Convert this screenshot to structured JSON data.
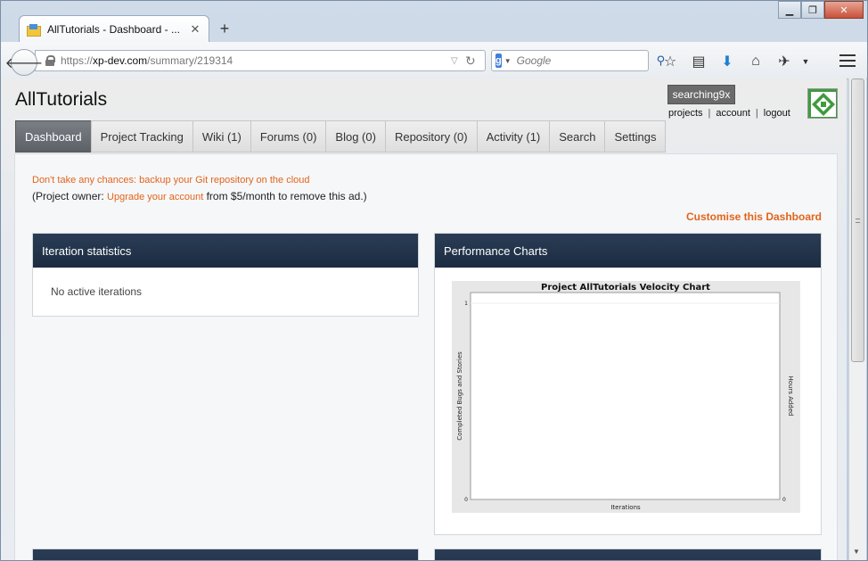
{
  "browser": {
    "tab_title": "AllTutorials - Dashboard - ...",
    "tab_close": "✕",
    "new_tab": "+",
    "url_prefix": "https://",
    "url_domain": "xp-dev.com",
    "url_path": "/summary/219314",
    "search_engine_letter": "g",
    "search_placeholder": "Google",
    "window_buttons": [
      "▁",
      "❐",
      "✕"
    ]
  },
  "site": {
    "title": "AllTutorials",
    "username": "searching9x",
    "user_links": [
      "projects",
      "account",
      "logout"
    ]
  },
  "nav": {
    "tabs": [
      {
        "label": "Dashboard",
        "active": true
      },
      {
        "label": "Project Tracking",
        "active": false
      },
      {
        "label": "Wiki (1)",
        "active": false
      },
      {
        "label": "Forums (0)",
        "active": false
      },
      {
        "label": "Blog (0)",
        "active": false
      },
      {
        "label": "Repository (0)",
        "active": false
      },
      {
        "label": "Activity (1)",
        "active": false
      },
      {
        "label": "Search",
        "active": false
      },
      {
        "label": "Settings",
        "active": false
      }
    ]
  },
  "ad": {
    "line1": "Don't take any chances: backup your Git repository on the cloud",
    "line2_prefix": "(Project owner: ",
    "line2_link": "Upgrade your account",
    "line2_suffix": " from $5/month to remove this ad.)"
  },
  "dashboard": {
    "customise": "Customise this Dashboard",
    "widgets": {
      "iteration": {
        "title": "Iteration statistics",
        "body": "No active iterations"
      },
      "performance": {
        "title": "Performance Charts"
      }
    }
  },
  "colors": {
    "accent_orange": "#e2641c",
    "widget_header": "#1f2f45"
  },
  "chart_data": {
    "type": "line",
    "title": "Project AllTutorials Velocity Chart",
    "xlabel": "Iterations",
    "ylabel": "Completed Bugs and Stories",
    "y2label": "Hours Added",
    "categories": [],
    "series": [],
    "ylim": [
      0,
      1
    ],
    "y2lim": [
      0,
      0
    ],
    "yticks": [
      "1",
      "0"
    ],
    "y2ticks": [
      "0"
    ],
    "grid": true
  }
}
